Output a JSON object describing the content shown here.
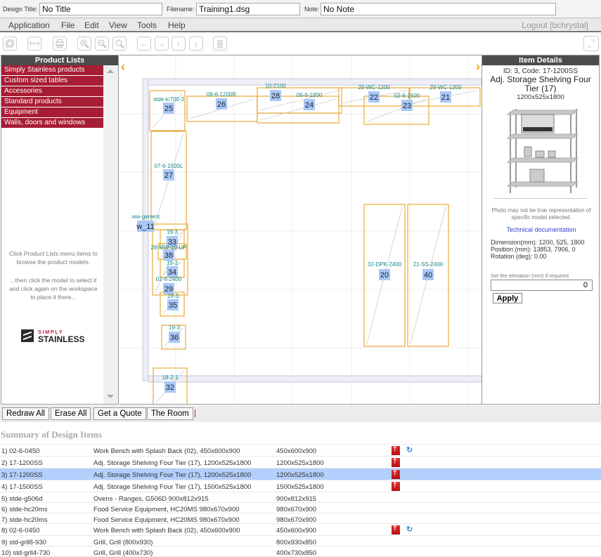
{
  "header": {
    "design_title_label": "Design Title:",
    "design_title_value": "No Title",
    "filename_label": "Filename:",
    "filename_value": "Training1.dsg",
    "note_label": "Note:",
    "note_value": "No Note"
  },
  "menu": {
    "items": [
      "Application",
      "File",
      "Edit",
      "View",
      "Tools",
      "Help"
    ],
    "logout": "Logout [bchrystal]"
  },
  "toolbar": {
    "icons": [
      "3d-view-icon",
      "measure-icon",
      "print-icon",
      "zoom-in-icon",
      "zoom-out-icon",
      "zoom-reset-icon",
      "arrow-left-icon",
      "arrow-right-icon",
      "arrow-up-icon",
      "arrow-down-icon",
      "trash-icon"
    ],
    "fullscreen_icon": "fullscreen-icon"
  },
  "left_panel": {
    "title": "Product Lists",
    "items": [
      "Simply Stainless products",
      "Custom sized tables",
      "Accessories",
      "Standard products",
      "Equipment",
      "Walls, doors and windows"
    ],
    "hint_1": "Click Product Lists menu items to browse the product models.",
    "hint_2": "...then click the model to select it and click again on the workspace to place it there...",
    "logo_small": "SIMPLY",
    "logo_big": "STAINLESS"
  },
  "canvas": {
    "left_arrow": "‹",
    "right_arrow": "›",
    "items": [
      {
        "label": "stde-lc700-3",
        "id": "25"
      },
      {
        "label": "08-6-1200R",
        "id": "26"
      },
      {
        "label": "10-2100",
        "id": "28"
      },
      {
        "label": "06-6-1800",
        "id": "24"
      },
      {
        "label": "29-WC-1200",
        "id": "22"
      },
      {
        "label": "02-6-1500",
        "id": "23"
      },
      {
        "label": "29-WC-1200",
        "id": "21"
      },
      {
        "label": "07-6-1500L",
        "id": "27"
      },
      {
        "label": "ww-generic",
        "id": "w_11"
      },
      {
        "label": "19-3",
        "id": "33"
      },
      {
        "label": "28-MW-10-UP",
        "id": "38"
      },
      {
        "label": "19-3",
        "id": "34"
      },
      {
        "label": "02-6-2400",
        "id": "29"
      },
      {
        "label": "19-3",
        "id": "35"
      },
      {
        "label": "19-3",
        "id": "36"
      },
      {
        "label": "18-2-1",
        "id": "32"
      },
      {
        "label": "32-DPK-2400",
        "id": "20"
      },
      {
        "label": "21-SS-2400",
        "id": "40"
      }
    ]
  },
  "item_details": {
    "title": "Item Details",
    "id_code": "ID: 3, Code: 17-1200SS",
    "name": "Adj. Storage Shelving Four Tier (17)",
    "dims": "1200x525x1800",
    "photo_note": "Photo may not be true representation of specific model selected.",
    "tech_doc_link": "Technical documentation",
    "dimension": "Dimension(mm): 1200, 525, 1800",
    "position": "Position (mm): 13853, 7906, 0",
    "rotation": "Rotation (deg): 0.00",
    "elevation_label": "Set the elevation (mm) if required",
    "elevation_value": "0",
    "apply_label": "Apply"
  },
  "actions": {
    "redraw": "Redraw All",
    "erase": "Erase All",
    "quote": "Get a Quote",
    "room": "The Room"
  },
  "summary": {
    "title": "Summary of Design Items",
    "rows": [
      {
        "code": "1) 02-6-0450",
        "desc": "Work Bench with Splash Back (02), 450x600x900",
        "size": "450x600x900",
        "pdf": true,
        "sync": true,
        "selected": false
      },
      {
        "code": "2) 17-1200SS",
        "desc": "Adj. Storage Shelving Four Tier (17), 1200x525x1800",
        "size": "1200x525x1800",
        "pdf": true,
        "sync": false,
        "selected": false
      },
      {
        "code": "3) 17-1200SS",
        "desc": "Adj. Storage Shelving Four Tier (17), 1200x525x1800",
        "size": "1200x525x1800",
        "pdf": true,
        "sync": false,
        "selected": true
      },
      {
        "code": "4) 17-1500SS",
        "desc": "Adj. Storage Shelving Four Tier (17), 1500x525x1800",
        "size": "1500x525x1800",
        "pdf": true,
        "sync": false,
        "selected": false
      },
      {
        "code": "5) stde-g506d",
        "desc": "Ovens - Ranges, G506D 900x812x915",
        "size": "900x812x915",
        "pdf": false,
        "sync": false,
        "selected": false
      },
      {
        "code": "6) stde-hc20ms",
        "desc": "Food Service Equipment, HC20MS 980x670x900",
        "size": "980x670x900",
        "pdf": false,
        "sync": false,
        "selected": false
      },
      {
        "code": "7) stde-hc20ms",
        "desc": "Food Service Equipment, HC20MS 980x670x900",
        "size": "980x670x900",
        "pdf": false,
        "sync": false,
        "selected": false
      },
      {
        "code": "8) 02-6-0450",
        "desc": "Work Bench with Splash Back (02), 450x600x900",
        "size": "450x600x900",
        "pdf": true,
        "sync": true,
        "selected": false
      },
      {
        "code": "9) std-grll8-930",
        "desc": "Grill, Grill (800x930)",
        "size": "800x930x850",
        "pdf": false,
        "sync": false,
        "selected": false
      },
      {
        "code": "10) std-grll4-730",
        "desc": "Grill, Grill (400x730)",
        "size": "400x730x850",
        "pdf": false,
        "sync": false,
        "selected": false
      }
    ]
  },
  "colors": {
    "accent_red": "#a71d34",
    "panel_header": "#4c4c4c",
    "selection": "#b3cffb",
    "item_outline": "#e8a93a",
    "label_teal": "#1a8a8a",
    "badge_blue": "#a9c8f7"
  }
}
